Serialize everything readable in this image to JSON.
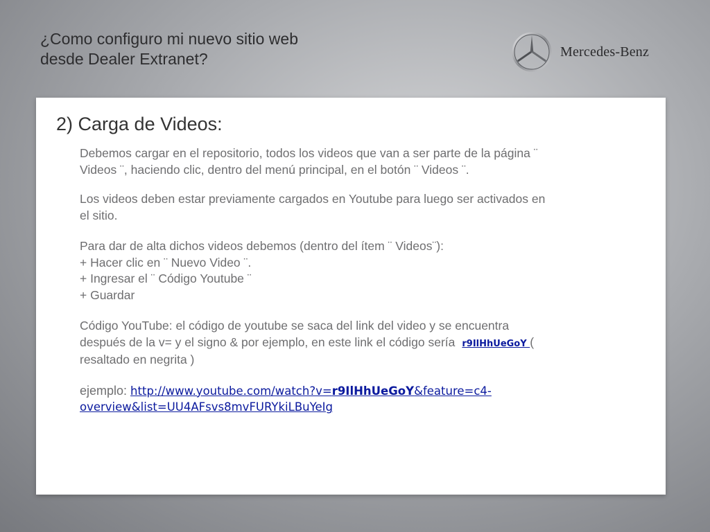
{
  "header": {
    "title_line1": "¿Como configuro mi nuevo sitio web",
    "title_line2": "desde Dealer Extranet?",
    "brand_name": "Mercedes-Benz",
    "logo_icon": "mercedes-star-icon"
  },
  "slide": {
    "section_title": "2) Carga de Videos:",
    "para1_line1": "Debemos cargar en el repositorio, todos los videos que van a ser parte de la página ¨",
    "para1_line2": "Videos ¨, haciendo clic, dentro del menú principal, en el botón ¨ Videos ¨.",
    "para2_line1": "Los videos deben estar previamente cargados en Youtube para luego ser activados en",
    "para2_line2": "el sitio.",
    "para3_line1": "Para dar de alta dichos videos debemos (dentro del ítem ¨ Videos¨):",
    "para3_line2": "+ Hacer clic en ¨ Nuevo Video ¨.",
    "para3_line3": "+ Ingresar el ¨ Código Youtube ¨",
    "para3_line4": "+ Guardar",
    "para4_line1": "Código YouTube: el código de youtube se saca del link del video y se encuentra",
    "para4_line2_prefix": "después de la v= y el signo & por ejemplo, en este link el código sería",
    "para4_code": "r9IlHhUeGoY ",
    "para4_line2_suffix": " (",
    "para4_line3": "resaltado en negrita )",
    "example_label": "ejemplo: ",
    "link_part1": "http://www.youtube.com/watch?v=",
    "link_bold": "r9IlHhUeGoY",
    "link_part2": "&feature=c4-",
    "link_line2": "overview&list=UU4AFsvs8mvFURYkiLBuYeIg"
  }
}
